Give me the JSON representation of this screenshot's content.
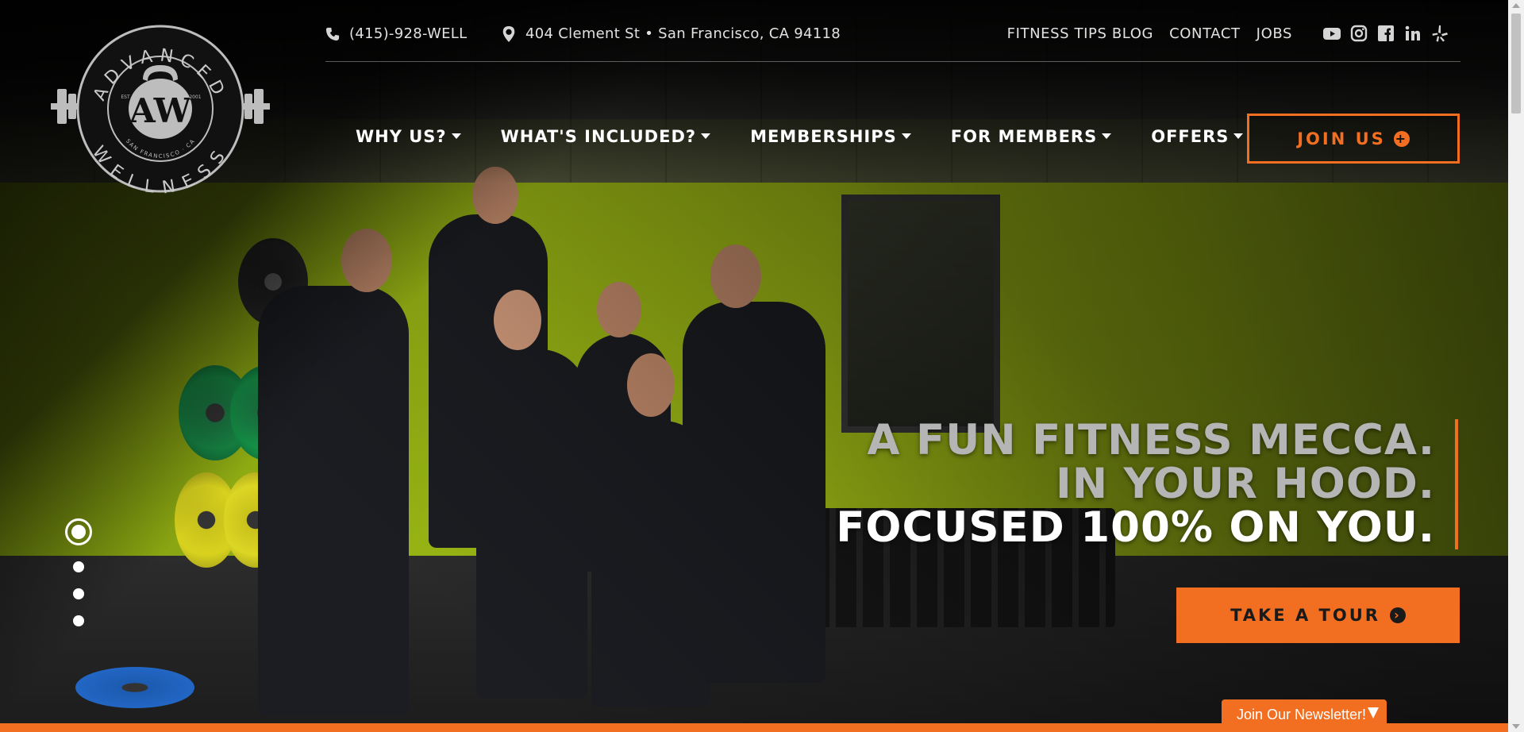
{
  "header": {
    "logo": {
      "top_text": "ADVANCED",
      "bottom_text": "WELLNESS",
      "monogram": "AW",
      "est": "EST",
      "year": "2001",
      "city": "SAN FRANCISCO · CA"
    },
    "phone": "(415)-928-WELL",
    "address": "404 Clement St • San Francisco, CA 94118",
    "top_links": [
      "FITNESS TIPS BLOG",
      "CONTACT",
      "JOBS"
    ],
    "social": [
      "youtube-icon",
      "instagram-icon",
      "facebook-icon",
      "linkedin-icon",
      "yelp-icon"
    ],
    "nav": [
      "WHY US?",
      "WHAT'S INCLUDED?",
      "MEMBERSHIPS",
      "FOR MEMBERS",
      "OFFERS"
    ],
    "join_label": "JOIN US"
  },
  "hero": {
    "headline": [
      "A FUN FITNESS MECCA.",
      "IN YOUR HOOD.",
      "FOCUSED 100% ON YOU."
    ],
    "cta_label": "TAKE A TOUR",
    "slides": {
      "count": 4,
      "active": 1
    }
  },
  "newsletter": {
    "label": "Join Our Newsletter!"
  },
  "colors": {
    "accent": "#f26f21",
    "wall": "#a8c416",
    "headline_grey": "#b5b5b5"
  }
}
